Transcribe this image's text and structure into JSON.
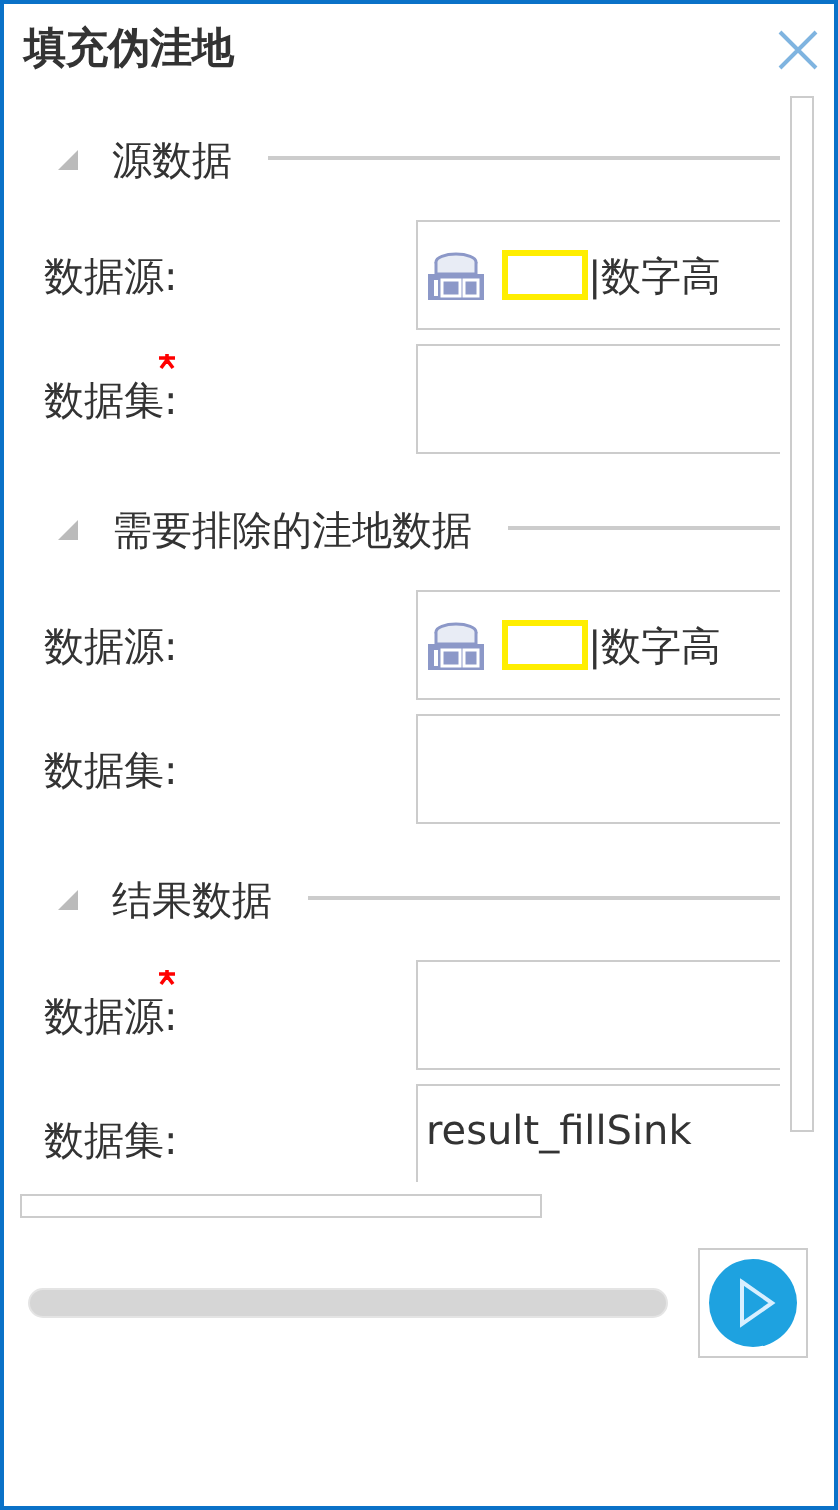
{
  "window": {
    "title": "填充伪洼地"
  },
  "sections": [
    {
      "title": "源数据",
      "expanded": true,
      "rows": [
        {
          "label": "数据源:",
          "required": false,
          "kind": "datasource",
          "value": "|数字高"
        },
        {
          "label": "数据集:",
          "required": true,
          "kind": "dataset"
        }
      ]
    },
    {
      "title": "需要排除的洼地数据",
      "expanded": true,
      "rows": [
        {
          "label": "数据源:",
          "required": false,
          "kind": "datasource",
          "value": "|数字高"
        },
        {
          "label": "数据集:",
          "required": false,
          "kind": "dataset"
        }
      ]
    },
    {
      "title": "结果数据",
      "expanded": true,
      "rows": [
        {
          "label": "数据源:",
          "required": true,
          "kind": "datasource"
        },
        {
          "label": "数据集:",
          "required": false,
          "kind": "dataset",
          "value": "result_fillSink"
        }
      ]
    }
  ],
  "progress": {
    "level": 0
  }
}
